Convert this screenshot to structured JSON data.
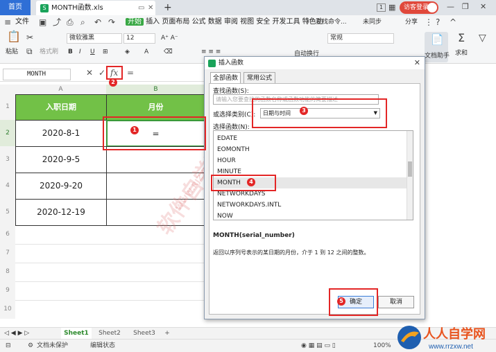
{
  "tabbar": {
    "home": "首页",
    "file": "MONTH函数.xls",
    "plus": "+",
    "badge_number": "1",
    "login": "访客登录"
  },
  "ribbon": {
    "file_menu": "文件",
    "menus": [
      "开始",
      "插入",
      "页面布局",
      "公式",
      "数据",
      "审阅",
      "视图",
      "安全",
      "开发工具",
      "特色功"
    ],
    "search": "查找命令...",
    "sync": "未同步",
    "share": "分享",
    "font": "微软雅黑",
    "size": "12",
    "format": "常规",
    "paste": "粘贴",
    "format_painter": "格式刷",
    "autowrap": "自动换行",
    "doc_assistant": "文档助手",
    "sum": "求和"
  },
  "formula_bar": {
    "namebox": "MONTH",
    "cancel": "✕",
    "confirm": "✓",
    "fx": "fx",
    "content": "="
  },
  "sheet": {
    "columns": [
      "A",
      "B"
    ],
    "rows": [
      "1",
      "2",
      "3",
      "4",
      "5",
      "6",
      "7",
      "8",
      "9",
      "10"
    ],
    "header_a": "入职日期",
    "header_b": "月份",
    "dates": [
      "2020-8-1",
      "2020-9-5",
      "2020-9-20",
      "2020-12-19"
    ],
    "b2_value": "="
  },
  "dialog": {
    "title": "插入函数",
    "close": "✕",
    "tab_all": "全部函数",
    "tab_common": "常用公式",
    "search_label": "查找函数(S):",
    "search_placeholder": "请输入您要查找的函数名称或函数功能的简要描述",
    "category_label": "或选择类别(C):",
    "category_value": "日期与时间",
    "function_label": "选择函数(N):",
    "functions": [
      "EDATE",
      "EOMONTH",
      "HOUR",
      "MINUTE",
      "MONTH",
      "NETWORKDAYS",
      "NETWORKDAYS.INTL",
      "NOW"
    ],
    "selected_function": "MONTH",
    "signature": "MONTH(serial_number)",
    "description": "返回以序列号表示的某日期的月份，介于 1 到 12 之间的整数。",
    "ok": "确定",
    "cancel": "取消"
  },
  "annotations": {
    "steps": [
      "1",
      "2",
      "3",
      "4",
      "5"
    ],
    "color": "#e32626"
  },
  "sheettabs": {
    "tabs": [
      "Sheet1",
      "Sheet2",
      "Sheet3"
    ],
    "add": "+"
  },
  "status": {
    "doc_protect": "文档未保护",
    "edit_state": "编辑状态",
    "zoom": "100%"
  },
  "watermark": {
    "text_cn": "软件自学网",
    "text_url": "WWW.RJZXW.COM"
  },
  "logo": {
    "brand": "人人自学网",
    "url": "www.rrzxw.net"
  },
  "colors": {
    "header_green": "#72c147",
    "accent_blue": "#2f6fd6",
    "annotation_red": "#e32626"
  }
}
